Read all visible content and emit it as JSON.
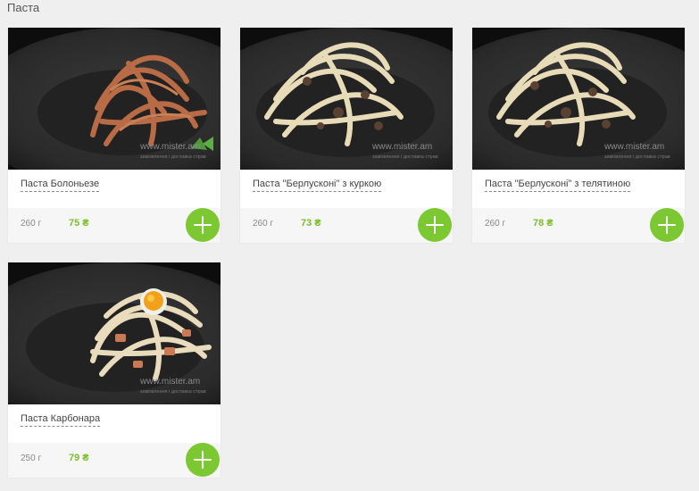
{
  "section": {
    "title": "Паста"
  },
  "watermark": {
    "site": "www.mister.am",
    "tagline": "замовлення і доставка страв"
  },
  "colors": {
    "accent": "#7cc832",
    "price": "#7cbf2a"
  },
  "products": [
    {
      "name": "Паста Болоньезе",
      "weight": "260 г",
      "price": "75 ₴",
      "add_icon": "plus-icon"
    },
    {
      "name": "Паста \"Берлусконі\" з куркою",
      "weight": "260 г",
      "price": "73 ₴",
      "add_icon": "plus-icon"
    },
    {
      "name": "Паста \"Берлусконі\" з телятиною",
      "weight": "260 г",
      "price": "78 ₴",
      "add_icon": "plus-icon"
    },
    {
      "name": "Паста Карбонара",
      "weight": "250 г",
      "price": "79 ₴",
      "add_icon": "plus-icon"
    }
  ]
}
